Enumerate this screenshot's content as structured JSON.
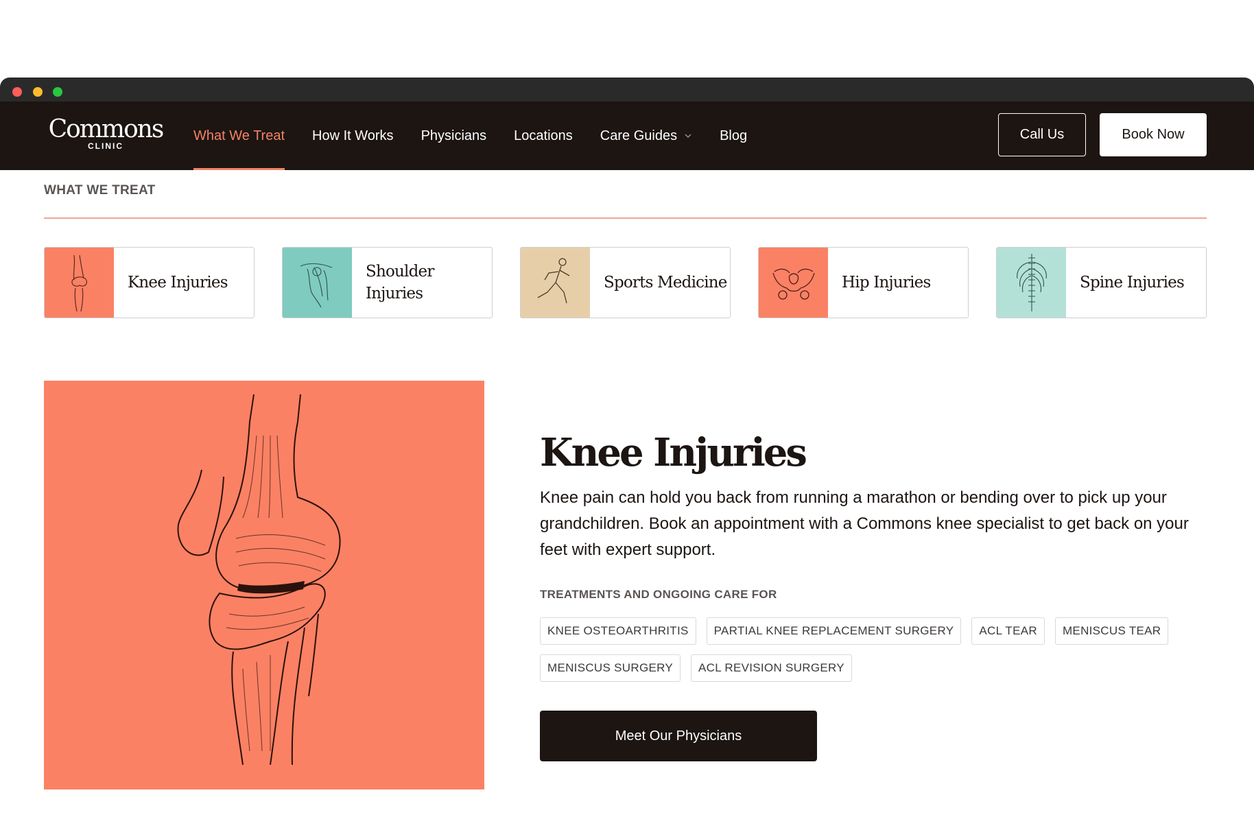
{
  "brand": {
    "name": "Commons",
    "sub": "CLINIC"
  },
  "nav": {
    "items": [
      {
        "label": "What We Treat",
        "active": true
      },
      {
        "label": "How It Works"
      },
      {
        "label": "Physicians"
      },
      {
        "label": "Locations"
      },
      {
        "label": "Care Guides",
        "dropdown": true
      },
      {
        "label": "Blog"
      }
    ],
    "call_label": "Call Us",
    "book_label": "Book Now"
  },
  "section": {
    "label": "WHAT WE TREAT"
  },
  "categories": [
    {
      "label": "Knee Injuries",
      "color": "#fb8164",
      "icon": "knee-illustration"
    },
    {
      "label": "Shoulder Injuries",
      "color": "#7fcbbf",
      "icon": "shoulder-illustration"
    },
    {
      "label": "Sports Medicine",
      "color": "#e6cfa8",
      "icon": "runner-illustration"
    },
    {
      "label": "Hip Injuries",
      "color": "#fb8164",
      "icon": "pelvis-illustration"
    },
    {
      "label": "Spine Injuries",
      "color": "#b3e1d8",
      "icon": "spine-illustration"
    }
  ],
  "detail": {
    "title": "Knee Injuries",
    "description": "Knee pain can hold you back from running a marathon or bending over to pick up your grandchildren. Book an appointment with a Commons knee specialist to get back on your feet with expert support.",
    "subhead": "TREATMENTS AND ONGOING CARE FOR",
    "tags": [
      "KNEE OSTEOARTHRITIS",
      "PARTIAL KNEE REPLACEMENT SURGERY",
      "ACL TEAR",
      "MENISCUS TEAR",
      "MENISCUS SURGERY",
      "ACL REVISION SURGERY"
    ],
    "cta": "Meet Our Physicians"
  },
  "colors": {
    "accent": "#f58266",
    "dark": "#1c1512",
    "coral": "#fb8164"
  }
}
